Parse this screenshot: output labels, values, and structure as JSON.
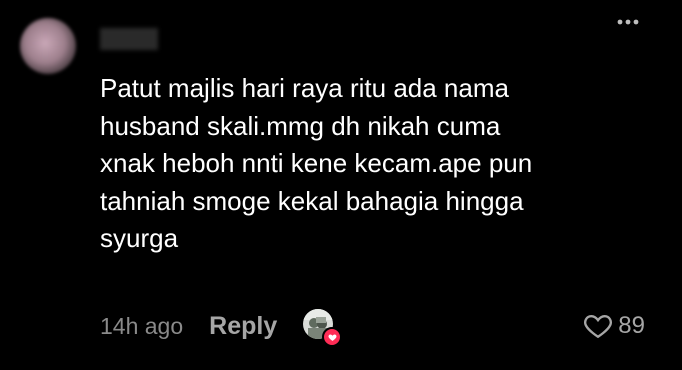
{
  "comment": {
    "text": "Patut majlis hari raya ritu ada nama\nhusband skali.mmg dh nikah cuma\nxnak heboh nnti kene kecam.ape pun\ntahniah smoge kekal bahagia hingga\nsyurga",
    "timestamp": "14h ago",
    "reply_label": "Reply",
    "like_count": "89"
  },
  "icons": {
    "more": "more-dots-icon",
    "like": "heart-outline-icon",
    "creator_liked": "creator-liked-heart-icon"
  },
  "colors": {
    "background": "#000000",
    "text": "#ffffff",
    "muted": "#8a8a8a",
    "accent": "#fe2c55"
  }
}
